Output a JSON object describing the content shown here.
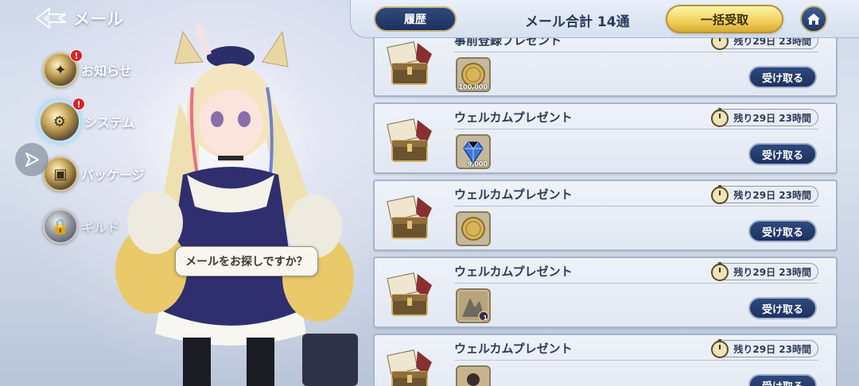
{
  "header": {
    "title": "メール",
    "history_label": "履歴",
    "mail_total": "メール合計 14通",
    "collect_all_label": "一括受取"
  },
  "sidebar": {
    "items": [
      {
        "label": "お知らせ",
        "badge": "!"
      },
      {
        "label": "システム",
        "badge": "!"
      },
      {
        "label": "パッケージ",
        "badge": ""
      },
      {
        "label": "ギルド",
        "badge": ""
      }
    ]
  },
  "speech_bubble": "メールをお探しですか？",
  "mails": [
    {
      "title": "事前登録プレゼント",
      "time_left": "残り29日 23時間",
      "item": "gold-coin",
      "qty": "100,000",
      "claim_label": "受け取る"
    },
    {
      "title": "ウェルカムプレゼント",
      "time_left": "残り29日 23時間",
      "item": "blue-gem",
      "qty": "9,000",
      "claim_label": "受け取る"
    },
    {
      "title": "ウェルカムプレゼント",
      "time_left": "残り29日 23時間",
      "item": "gold-coin",
      "qty": "",
      "claim_label": "受け取る"
    },
    {
      "title": "ウェルカムプレゼント",
      "time_left": "残り29日 23時間",
      "item": "card",
      "qty": "1",
      "claim_label": "受け取る"
    },
    {
      "title": "ウェルカムプレゼント",
      "time_left": "残り29日 23時間",
      "item": "character-card",
      "qty": "",
      "claim_label": "受け取る"
    }
  ],
  "colors": {
    "accent_navy": "#1d3160",
    "accent_gold": "#f0cf5a",
    "badge_red": "#d8232a"
  }
}
